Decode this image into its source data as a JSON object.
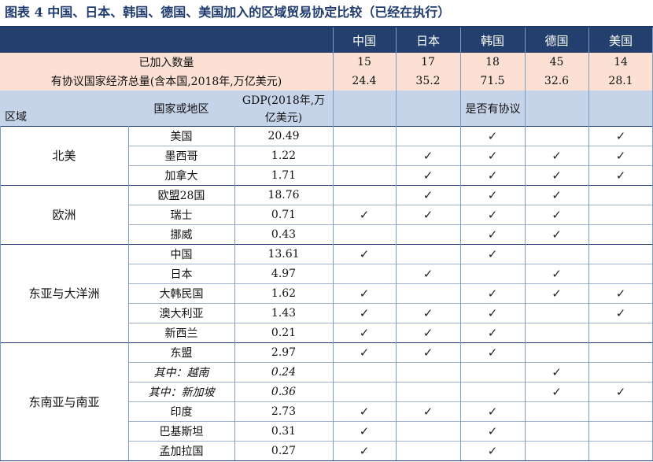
{
  "title": "图表 4  中国、日本、韩国、德国、美国加入的区域贸易协定比较（已经在执行）",
  "countries": [
    "中国",
    "日本",
    "韩国",
    "德国",
    "美国"
  ],
  "summary": {
    "count_label": "已加入数量",
    "counts": [
      "15",
      "17",
      "18",
      "45",
      "14"
    ],
    "gdp_label": "有协议国家经济总量(含本国,2018年,万亿美元)",
    "gdp_totals": [
      "24.4",
      "35.2",
      "71.5",
      "32.6",
      "28.1"
    ]
  },
  "columns": {
    "region": "区域",
    "country": "国家或地区",
    "gdp_line1": "GDP(2018年,万",
    "gdp_line2": "亿美元)",
    "agreement": "是否有协议"
  },
  "check_mark": "✓",
  "regions": [
    {
      "name": "北美",
      "rows": [
        {
          "country": "美国",
          "gdp": "20.49",
          "italic": false,
          "checks": [
            false,
            false,
            true,
            false,
            true
          ]
        },
        {
          "country": "墨西哥",
          "gdp": "1.22",
          "italic": false,
          "checks": [
            false,
            true,
            true,
            true,
            true
          ]
        },
        {
          "country": "加拿大",
          "gdp": "1.71",
          "italic": false,
          "checks": [
            false,
            true,
            true,
            true,
            true
          ]
        }
      ]
    },
    {
      "name": "欧洲",
      "rows": [
        {
          "country": "欧盟28国",
          "gdp": "18.76",
          "italic": false,
          "checks": [
            false,
            true,
            true,
            true,
            false
          ]
        },
        {
          "country": "瑞士",
          "gdp": "0.71",
          "italic": false,
          "checks": [
            true,
            true,
            true,
            true,
            false
          ]
        },
        {
          "country": "挪威",
          "gdp": "0.43",
          "italic": false,
          "checks": [
            false,
            false,
            true,
            true,
            false
          ]
        }
      ]
    },
    {
      "name": "东亚与大洋洲",
      "rows": [
        {
          "country": "中国",
          "gdp": "13.61",
          "italic": false,
          "checks": [
            true,
            false,
            true,
            false,
            false
          ]
        },
        {
          "country": "日本",
          "gdp": "4.97",
          "italic": false,
          "checks": [
            false,
            true,
            false,
            true,
            false
          ]
        },
        {
          "country": "大韩民国",
          "gdp": "1.62",
          "italic": false,
          "checks": [
            true,
            false,
            true,
            true,
            true
          ]
        },
        {
          "country": "澳大利亚",
          "gdp": "1.43",
          "italic": false,
          "checks": [
            true,
            true,
            true,
            false,
            true
          ]
        },
        {
          "country": "新西兰",
          "gdp": "0.21",
          "italic": false,
          "checks": [
            true,
            true,
            true,
            false,
            false
          ]
        }
      ]
    },
    {
      "name": "东南亚与南亚",
      "rows": [
        {
          "country": "东盟",
          "gdp": "2.97",
          "italic": false,
          "checks": [
            true,
            true,
            true,
            false,
            false
          ]
        },
        {
          "country": "其中：越南",
          "gdp": "0.24",
          "italic": true,
          "checks": [
            false,
            false,
            false,
            true,
            false
          ]
        },
        {
          "country": "其中：新加坡",
          "gdp": "0.36",
          "italic": true,
          "checks": [
            false,
            false,
            false,
            true,
            true
          ]
        },
        {
          "country": "印度",
          "gdp": "2.73",
          "italic": false,
          "checks": [
            true,
            true,
            true,
            false,
            false
          ]
        },
        {
          "country": "巴基斯坦",
          "gdp": "0.31",
          "italic": false,
          "checks": [
            true,
            false,
            true,
            false,
            false
          ]
        },
        {
          "country": "孟加拉国",
          "gdp": "0.27",
          "italic": false,
          "checks": [
            true,
            false,
            true,
            false,
            false
          ]
        }
      ]
    }
  ]
}
